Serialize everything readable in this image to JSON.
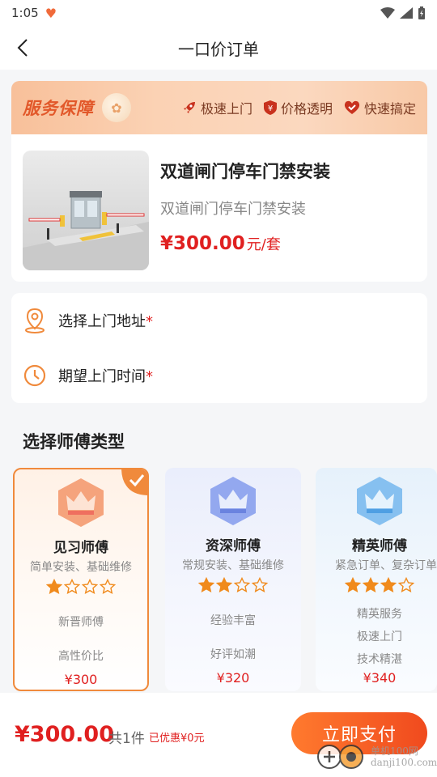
{
  "status_bar": {
    "time": "1:05"
  },
  "nav": {
    "title": "一口价订单"
  },
  "banner": {
    "title": "服务保障",
    "tags": [
      {
        "label": "极速上门",
        "icon": "rocket-icon"
      },
      {
        "label": "价格透明",
        "icon": "yen-shield-icon"
      },
      {
        "label": "快速搞定",
        "icon": "heart-check-icon"
      }
    ]
  },
  "product": {
    "name": "双道闸门停车门禁安装",
    "subtitle": "双道闸门停车门禁安装",
    "price": "¥300.00",
    "unit": "元/套"
  },
  "form": {
    "address_label": "选择上门地址",
    "time_label": "期望上门时间",
    "required_mark": "*"
  },
  "section": {
    "title": "选择师傅类型"
  },
  "masters": [
    {
      "name": "见习师傅",
      "desc": "简单安装、基础维修",
      "stars": 1,
      "features": [
        "新晋师傅",
        "高性价比"
      ],
      "price": "¥300",
      "selected": true
    },
    {
      "name": "资深师傅",
      "desc": "常规安装、基础维修",
      "stars": 2,
      "features": [
        "经验丰富",
        "好评如潮"
      ],
      "price": "¥320",
      "selected": false
    },
    {
      "name": "精英师傅",
      "desc": "紧急订单、复杂订单",
      "stars": 3,
      "features": [
        "精英服务",
        "极速上门",
        "技术精湛"
      ],
      "price": "¥340",
      "selected": false
    }
  ],
  "footer": {
    "total": "¥300.00",
    "count": "共1件",
    "discount": "已优惠¥0元",
    "pay_label": "立即支付"
  },
  "watermark": {
    "line1": "单机100网",
    "line2": "danji100.com"
  },
  "colors": {
    "accent": "#f04a1e",
    "price": "#e02020",
    "orange": "#f08a3c"
  }
}
